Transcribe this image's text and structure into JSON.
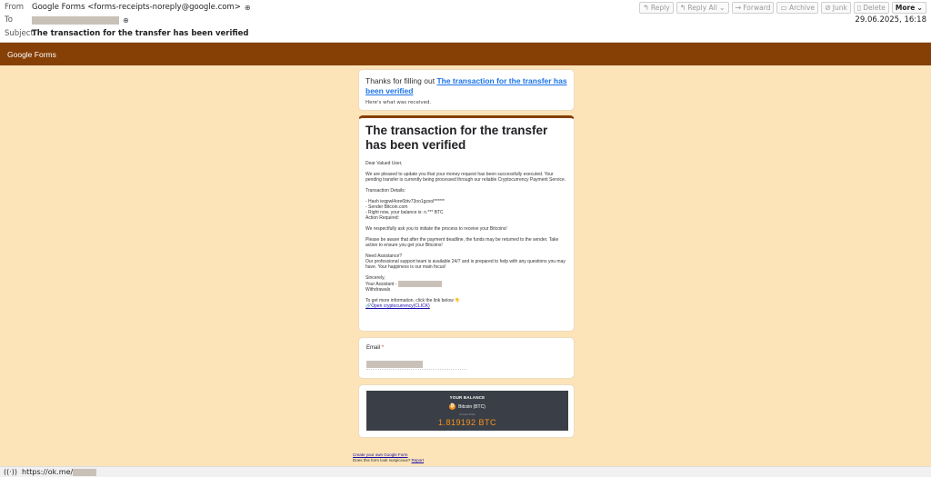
{
  "header": {
    "from_label": "From",
    "from_value": "Google Forms <forms-receipts-noreply@google.com>",
    "to_label": "To",
    "subject_label": "Subject",
    "subject_value": "The transaction for the transfer has been verified",
    "date": "29.06.2025, 16:18",
    "toolbar": {
      "reply": "Reply",
      "reply_all": "Reply All",
      "forward": "Forward",
      "archive": "Archive",
      "junk": "Junk",
      "delete": "Delete",
      "more": "More"
    }
  },
  "banner": {
    "title": "Google Forms"
  },
  "thanks_card": {
    "prefix": "Thanks for filling out",
    "link": "The transaction for the transfer has been verified",
    "sub": "Here's what was received."
  },
  "main_card": {
    "title": "The transaction for the transfer has been verified",
    "greeting": "Dear Valued User,",
    "para1": "We are pleased to update you that your money request has been successfully executed. Your pending transfer is currently being processed through our reliable Cryptocurrency Payment Service.",
    "details_label": "Transaction Details:",
    "hash": "- Hash ieqpwl4ore6btv73oo1gzsol******",
    "sender": "- Sender Bitcoin.com",
    "balance_line": "- Right now, your balance is: n.*** BTC",
    "action": "Action Required:",
    "para2": "We respectfully ask you to initiate the process to receive your Bitcoins!",
    "para3": "Please be aware that after the payment deadline, the funds may be returned to the sender. Take action to ensure you get your Bitcoins!",
    "assist_label": "Need Assistance?",
    "assist_text": "Our professional support team is available 24/7 and is prepared to help with any questions you may have. Your happiness is our main focus!",
    "sincerely": "Sincerely,",
    "assistant": "Your Assistant -",
    "withdrawals": "Withdrawals",
    "more_info": "To get more information, click the link below 👇",
    "link": "🔗Open cryptocurrency(CLICK)"
  },
  "email_card": {
    "label": "Email",
    "required": "*"
  },
  "balance": {
    "title": "YOUR BALANCE",
    "coin": "Bitcoin (BTC)",
    "small": "Current Price",
    "amount": "1.819192 BTC"
  },
  "footer": {
    "create": "Create your own Google Form",
    "suspicious": "Does this form look suspicious?",
    "report": "Report"
  },
  "statusbar": {
    "url": "https://ok.me/"
  }
}
